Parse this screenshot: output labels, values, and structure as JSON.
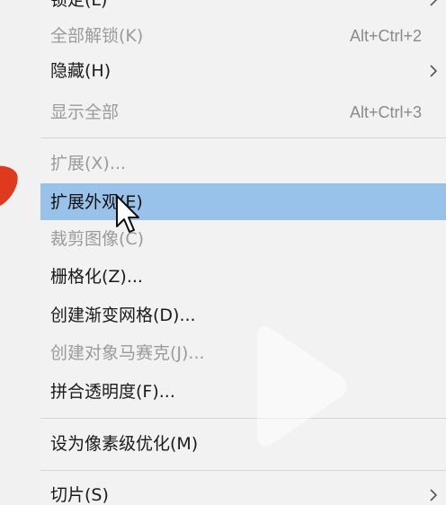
{
  "menu": {
    "items": [
      {
        "label": "锁定(L)",
        "shortcut": "",
        "disabled": false,
        "submenu": true
      },
      {
        "label": "全部解锁(K)",
        "shortcut": "Alt+Ctrl+2",
        "disabled": true,
        "submenu": false
      },
      {
        "label": "隐藏(H)",
        "shortcut": "",
        "disabled": false,
        "submenu": true
      },
      {
        "label": "显示全部",
        "shortcut": "Alt+Ctrl+3",
        "disabled": true,
        "submenu": false
      },
      {
        "label": "扩展(X)...",
        "shortcut": "",
        "disabled": true,
        "submenu": false
      },
      {
        "label": "扩展外观(E)",
        "shortcut": "",
        "disabled": false,
        "submenu": false,
        "highlighted": true
      },
      {
        "label": "裁剪图像(C)",
        "shortcut": "",
        "disabled": true,
        "submenu": false
      },
      {
        "label": "栅格化(Z)...",
        "shortcut": "",
        "disabled": false,
        "submenu": false
      },
      {
        "label": "创建渐变网格(D)...",
        "shortcut": "",
        "disabled": false,
        "submenu": false
      },
      {
        "label": "创建对象马赛克(J)...",
        "shortcut": "",
        "disabled": true,
        "submenu": false
      },
      {
        "label": "拼合透明度(F)...",
        "shortcut": "",
        "disabled": false,
        "submenu": false
      },
      {
        "label": "设为像素级优化(M)",
        "shortcut": "",
        "disabled": false,
        "submenu": false
      },
      {
        "label": "切片(S)",
        "shortcut": "",
        "disabled": false,
        "submenu": true
      }
    ]
  },
  "colors": {
    "highlight": "#99c2ea",
    "disabled_text": "#9b9b9b",
    "menu_bg": "#f2f2f2",
    "annotation_red": "#e03a1e"
  },
  "icons": {
    "submenu": "chevron-right-icon",
    "cursor": "mouse-pointer-icon",
    "overlay": "play-icon"
  }
}
